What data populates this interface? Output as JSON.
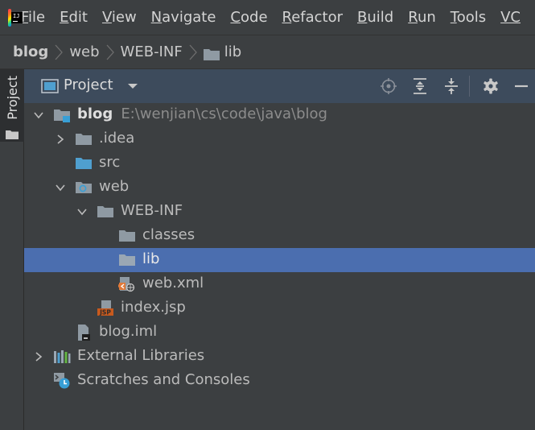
{
  "colors": {
    "background": "#3c3f41",
    "panel_header": "#3d4b5c",
    "selection": "#4b6eaf",
    "folder": "#8f9aa3",
    "source_folder": "#4f9fcf"
  },
  "menubar": {
    "app_icon": "intellij-idea-icon",
    "items": [
      {
        "mnemonic": "F",
        "rest": "ile"
      },
      {
        "mnemonic": "E",
        "rest": "dit"
      },
      {
        "mnemonic": "V",
        "rest": "iew"
      },
      {
        "mnemonic": "N",
        "rest": "avigate"
      },
      {
        "mnemonic": "C",
        "rest": "ode"
      },
      {
        "mnemonic": "R",
        "rest": "efactor"
      },
      {
        "mnemonic": "B",
        "rest": "uild"
      },
      {
        "mnemonic": "R",
        "rest": "un"
      },
      {
        "mnemonic": "T",
        "rest": "ools"
      },
      {
        "mnemonic": "VC",
        "rest": ""
      }
    ]
  },
  "breadcrumb": {
    "items": [
      "blog",
      "web",
      "WEB-INF",
      "lib"
    ]
  },
  "side_strip": {
    "tab_label": "Project"
  },
  "panel": {
    "title": "Project",
    "dropdown_icon": "chevron-down-icon",
    "header_icons": [
      "locate-icon",
      "expand-all-icon",
      "collapse-all-icon",
      "gear-icon",
      "minimize-icon"
    ]
  },
  "tree": {
    "blog": {
      "name": "blog",
      "path": "E:\\wenjian\\cs\\code\\java\\blog"
    },
    "idea": ".idea",
    "src": "src",
    "web": "web",
    "webinf": "WEB-INF",
    "classes": "classes",
    "lib": "lib",
    "webxml": "web.xml",
    "indexjsp": "index.jsp",
    "blogiml": "blog.iml",
    "extlibs": "External Libraries",
    "scratches": "Scratches and Consoles",
    "jsp_badge": "JSP"
  },
  "selected_item": "lib"
}
